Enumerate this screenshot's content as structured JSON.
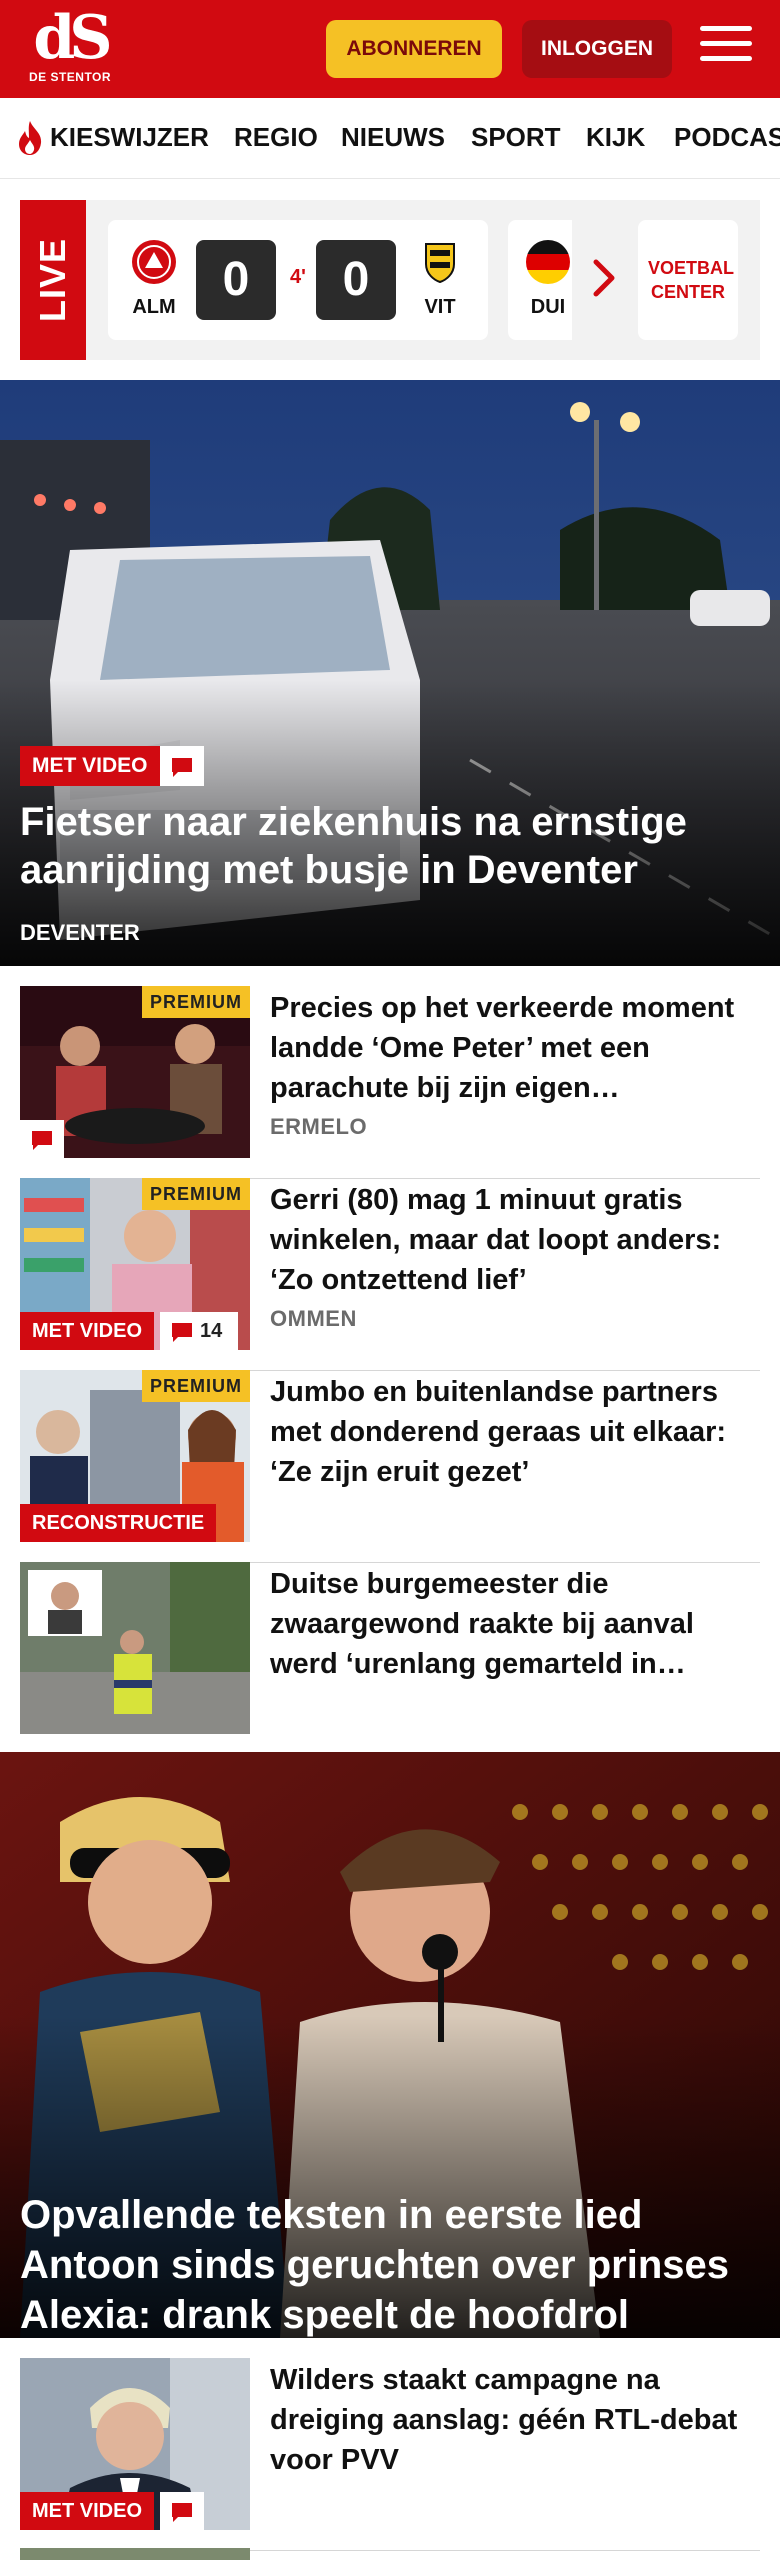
{
  "header": {
    "logo_mark": "dS",
    "logo_text": "DE STENTOR",
    "subscribe_label": "ABONNEREN",
    "login_label": "INLOGGEN"
  },
  "nav": {
    "items": [
      "KIESWIJZER",
      "REGIO",
      "NIEUWS",
      "SPORT",
      "KIJK",
      "PODCAS"
    ]
  },
  "live": {
    "label": "LIVE",
    "match": {
      "home": "ALM",
      "away": "VIT",
      "home_score": "0",
      "away_score": "0",
      "minute": "4'"
    },
    "next_team": "DUI",
    "voetbal_center": "VOETBAL CENTER"
  },
  "hero": {
    "badge": "MET VIDEO",
    "title": "Fietser naar ziekenhuis na ernstige aanrijding met busje in Deventer",
    "region": "DEVENTER"
  },
  "articles": [
    {
      "title": "Precies op het verkeerde moment landde ‘Ome Peter’ met een parachute bij zijn eigen…",
      "region": "ERMELO",
      "premium": "PREMIUM",
      "badge": "",
      "comments": ""
    },
    {
      "title": "Gerri (80) mag 1 minuut gratis winkelen, maar dat loopt anders: ‘Zo ontzettend lief’",
      "region": "OMMEN",
      "premium": "PREMIUM",
      "badge": "MET VIDEO",
      "comments": "14"
    },
    {
      "title": "Jumbo en buitenlandse partners met donderend geraas uit elkaar: ‘Ze zijn eruit gezet’",
      "region": "",
      "premium": "PREMIUM",
      "badge": "RECONSTRUCTIE",
      "comments": ""
    },
    {
      "title": "Duitse burgemeester die zwaargewond raakte bij aanval werd ‘urenlang gemarteld in…",
      "region": "",
      "premium": "",
      "badge": "",
      "comments": ""
    }
  ],
  "hero2": {
    "title": "Opvallende teksten in eerste lied Antoon sinds geruchten over prinses Alexia: drank speelt de hoofdrol"
  },
  "article_bottom": {
    "title": "Wilders staakt campagne na dreiging aanslag: géén RTL-debat voor PVV",
    "badge": "MET VIDEO"
  },
  "colors": {
    "brand_red": "#d10a11",
    "premium_yellow": "#f5c125",
    "login_dark_red": "#a50d12"
  }
}
